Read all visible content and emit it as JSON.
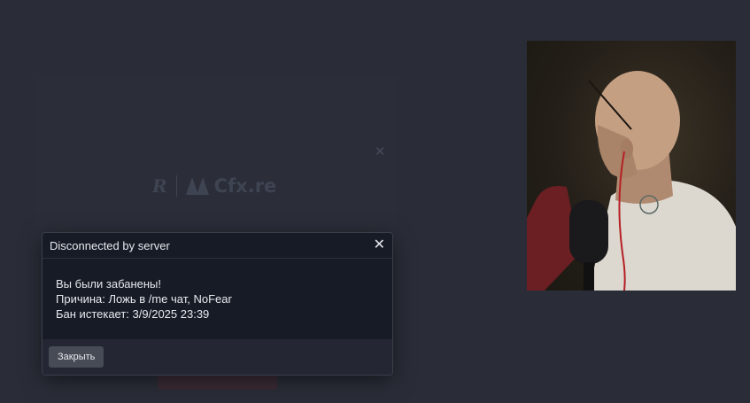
{
  "background": {
    "brand_logo": "rockstar-r-logo",
    "cfx_label": "Cfx.re"
  },
  "modal": {
    "title": "Disconnected by server",
    "close_icon": "close-icon",
    "lines": [
      "Вы были забанены!",
      "Причина: Ложь в /me чат, NoFear",
      "Бан истекает: 3/9/2025 23:39"
    ],
    "close_button_label": "Закрыть"
  },
  "webcam": {
    "description_icon": "webcam-feed"
  },
  "colors": {
    "page_bg": "#2a2d38",
    "modal_bg": "#171b26",
    "footer_bg": "#242733",
    "button_bg": "#474b56"
  }
}
